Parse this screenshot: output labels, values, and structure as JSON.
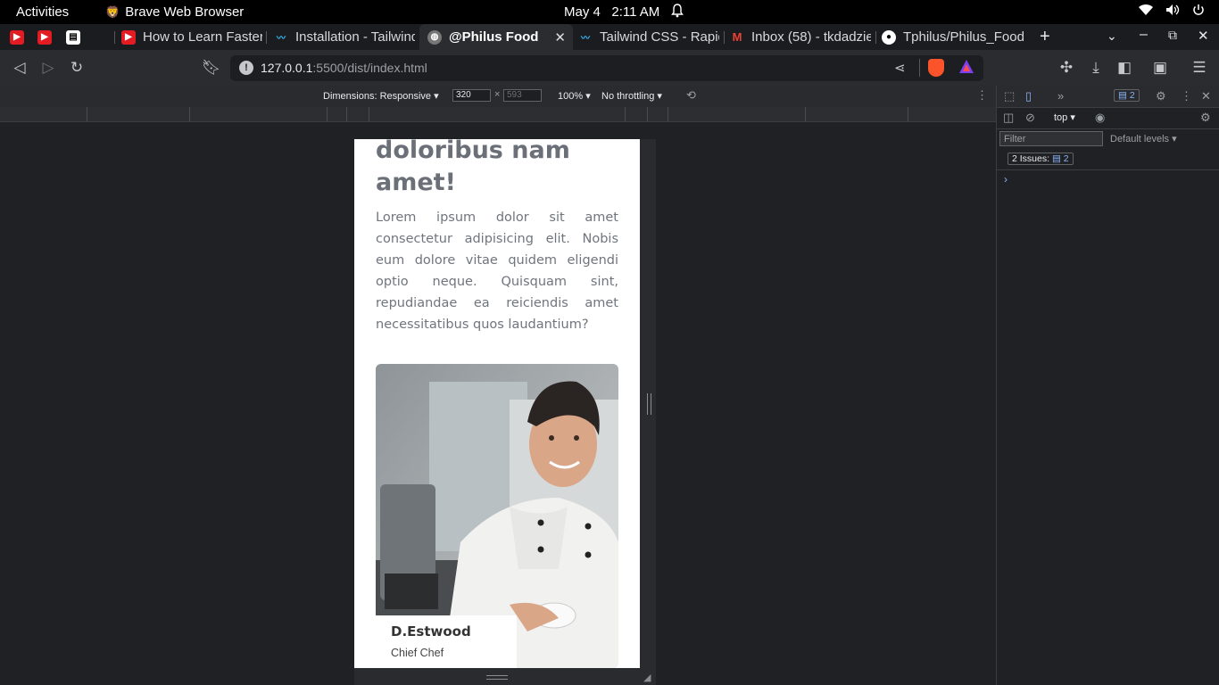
{
  "system_bar": {
    "activities": "Activities",
    "app_name": "Brave Web Browser",
    "date": "May 4",
    "time": "2:11 AM"
  },
  "tabs": [
    {
      "title": "",
      "icon": "youtube-icon"
    },
    {
      "title": "",
      "icon": "youtube-icon"
    },
    {
      "title": "",
      "icon": "page-icon"
    },
    {
      "title": "",
      "icon": "blank-icon"
    },
    {
      "title": "How to Learn Faster",
      "icon": "youtube-icon"
    },
    {
      "title": "Installation - Tailwind",
      "icon": "tailwind-icon"
    },
    {
      "title": "@Philus Food",
      "icon": "globe-icon",
      "active": true
    },
    {
      "title": "Tailwind CSS - Rapid",
      "icon": "tailwind-icon"
    },
    {
      "title": "Inbox (58) - tkdadzie",
      "icon": "gmail-icon"
    },
    {
      "title": "Tphilus/Philus_Food",
      "icon": "github-icon"
    }
  ],
  "toolbar": {
    "url_host": "127.0.0.1",
    "url_path": ":5500/dist/index.html"
  },
  "device_toolbar": {
    "dimensions": "Dimensions: Responsive",
    "width": "320",
    "height": "593",
    "zoom": "100%",
    "throttling": "No throttling"
  },
  "page": {
    "heading": "doloribus nam amet!",
    "paragraph": "Lorem ipsum dolor sit amet consectetur adipisicing elit. Nobis eum dolore vitae quidem eligendi optio neque. Quisquam sint, repudiandae ea reiciendis amet necessitatibus quos laudantium?",
    "chef_name": "D.Estwood",
    "chef_role": "Chief Chef"
  },
  "devtools": {
    "issues_count": "2",
    "context": "top",
    "filter_placeholder": "Filter",
    "levels": "Default levels",
    "issues_label": "2 Issues:",
    "issues_badge": "2"
  },
  "colors": {
    "accent_blue": "#8ab4f8",
    "youtube_red": "#e31b23",
    "brave_orange": "#fb542b"
  }
}
